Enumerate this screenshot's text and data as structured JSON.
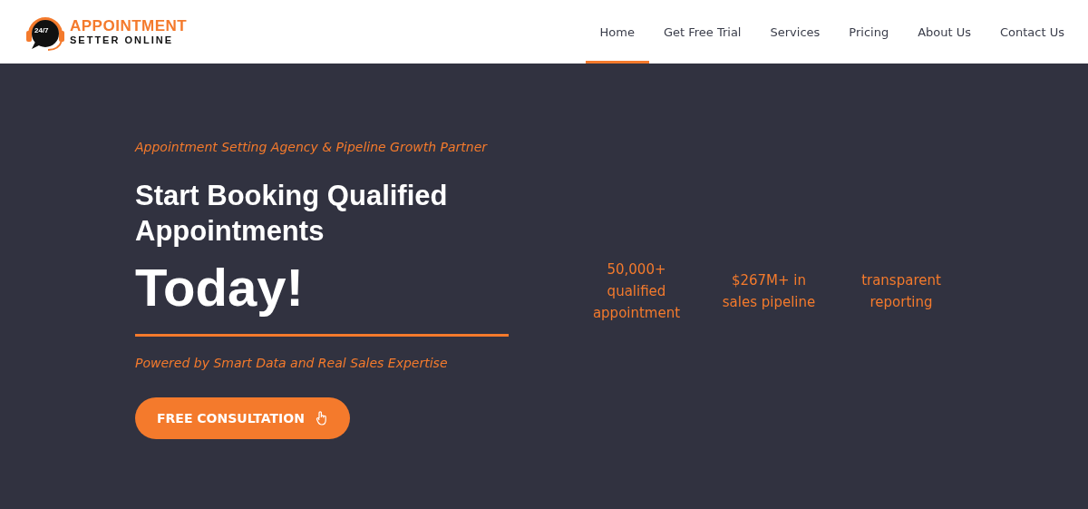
{
  "logo": {
    "badge": "24/7",
    "name_top": "APPOINTMENT",
    "name_bottom": "SETTER ONLINE"
  },
  "nav": [
    {
      "label": "Home",
      "selected": true
    },
    {
      "label": "Get Free Trial",
      "selected": false
    },
    {
      "label": "Services",
      "selected": false
    },
    {
      "label": "Pricing",
      "selected": false
    },
    {
      "label": "About Us",
      "selected": false
    },
    {
      "label": "Contact Us",
      "selected": false
    }
  ],
  "hero": {
    "tagline": "Appointment Setting Agency & Pipeline Growth Partner",
    "headline": "Start Booking Qualified Appointments",
    "highlight": "Today!",
    "subline": "Powered by Smart Data and Real Sales Expertise",
    "button": "FREE CONSULTATION"
  },
  "stats": [
    "50,000+ qualified appointment",
    "$267M+ in sales pipeline",
    "transparent reporting"
  ]
}
